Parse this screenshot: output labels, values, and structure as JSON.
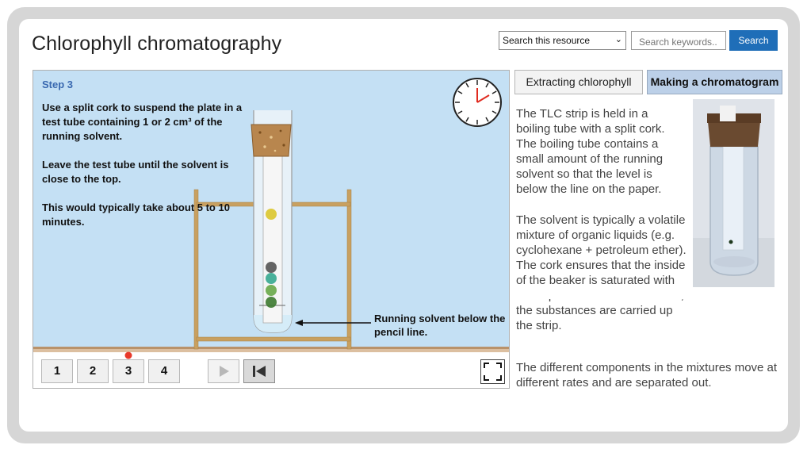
{
  "page": {
    "title": "Chlorophyll chromatography"
  },
  "search": {
    "scope_selected": "Search this resource",
    "placeholder": "Search keywords..",
    "button_label": "Search"
  },
  "simulation": {
    "step_label": "Step 3",
    "instructions": [
      "Use a split cork to suspend the plate in a test tube containing 1 or 2 cm³ of the running solvent.",
      "Leave the test tube until the solvent is close to the top.",
      "This would typically take about 5 to 10 minutes."
    ],
    "annotation": "Running solvent below the pencil line.",
    "step_buttons": [
      "1",
      "2",
      "3",
      "4"
    ],
    "current_step": 3,
    "clock_icon": "clock-icon",
    "play_icon": "play-icon",
    "rewind_icon": "skip-back-icon",
    "fullscreen_icon": "fullscreen-icon",
    "colors": {
      "background": "#c4e0f4",
      "bench": "#dcbfa0",
      "stand": "#c8a060",
      "indicator": "#e8392a"
    }
  },
  "tabs": [
    {
      "label": "Extracting chlorophyll",
      "active": false
    },
    {
      "label": "Making a chromatogram",
      "active": true
    }
  ],
  "content": {
    "paragraphs": [
      "The TLC strip is held in a boiling tube with a split cork. The boiling tube contains a small amount of the running solvent so that the level is below the line on the paper.",
      "The solvent is typically a volatile mixture of organic liquids (e.g. cyclohexane + petroleum ether). The cork ensures that the inside of the beaker is saturated with the vapour. As the solvent rises, the substances are carried up the strip.",
      "The different components in the mixtures move at different rates and are separated out."
    ]
  }
}
